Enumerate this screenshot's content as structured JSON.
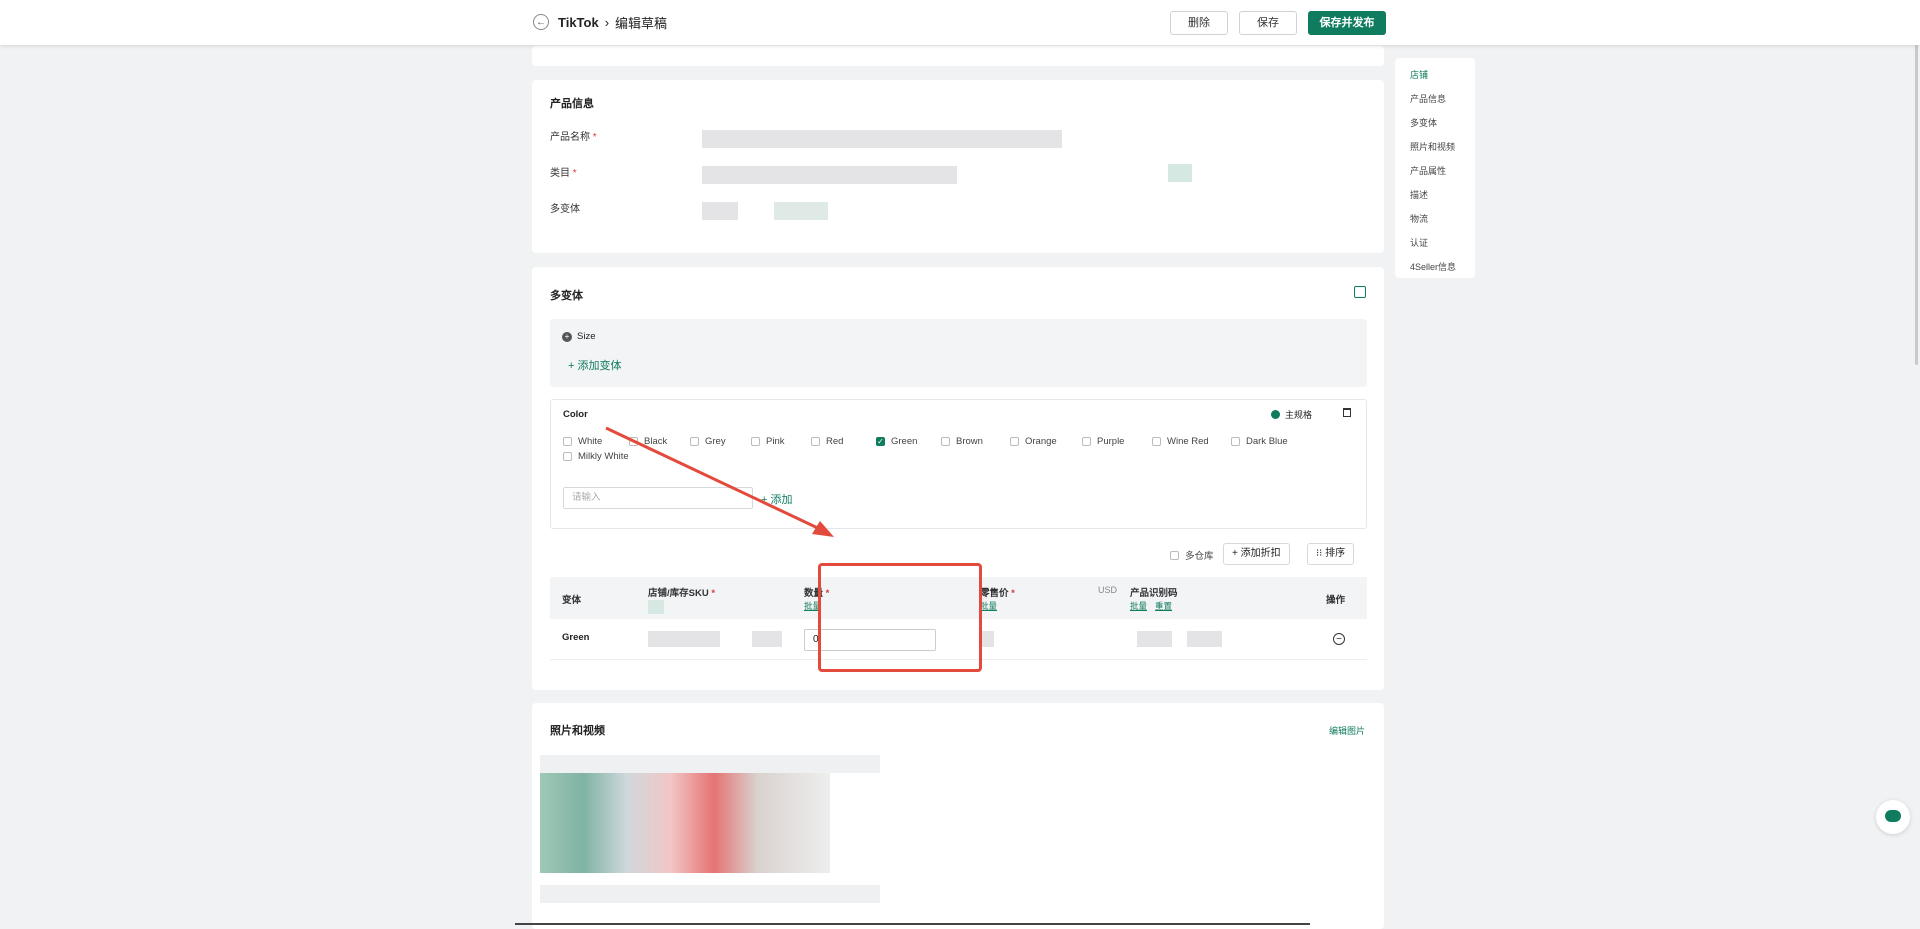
{
  "header": {
    "back_icon": "arrow-left-icon",
    "breadcrumb_root": "TikTok",
    "breadcrumb_sep": "›",
    "breadcrumb_page": "编辑草稿",
    "delete_label": "删除",
    "save_label": "保存",
    "save_publish_label": "保存并发布"
  },
  "product_info": {
    "title": "产品信息",
    "name_label": "产品名称",
    "category_label": "类目",
    "variants_label": "多变体",
    "required_mark": "*"
  },
  "variants": {
    "title": "多变体",
    "size_tag": "Size",
    "add_variant_label": "添加变体",
    "color_title": "Color",
    "main_spec_label": "主规格",
    "colors": [
      {
        "label": "White",
        "checked": false
      },
      {
        "label": "Black",
        "checked": false
      },
      {
        "label": "Grey",
        "checked": false
      },
      {
        "label": "Pink",
        "checked": false
      },
      {
        "label": "Red",
        "checked": false
      },
      {
        "label": "Green",
        "checked": true
      },
      {
        "label": "Brown",
        "checked": false
      },
      {
        "label": "Orange",
        "checked": false
      },
      {
        "label": "Purple",
        "checked": false
      },
      {
        "label": "Wine Red",
        "checked": false
      },
      {
        "label": "Dark Blue",
        "checked": false
      },
      {
        "label": "Milkly White",
        "checked": false
      }
    ],
    "input_placeholder": "请输入",
    "add_label": "添加",
    "multi_warehouse_label": "多仓库",
    "add_discount_label": "添加折扣",
    "sort_label": "排序",
    "table": {
      "col_variant": "变体",
      "col_sku": "店铺/库存SKU",
      "col_qty": "数量",
      "col_price": "零售价",
      "col_currency": "USD",
      "col_id": "产品识别码",
      "col_action": "操作",
      "batch_label": "批量",
      "reset_label": "重置",
      "rows": [
        {
          "variant": "Green",
          "qty": "0"
        }
      ]
    }
  },
  "media": {
    "title": "照片和视频",
    "edit_images_label": "编辑图片"
  },
  "side_nav": {
    "items": [
      "店铺",
      "产品信息",
      "多变体",
      "照片和视频",
      "产品属性",
      "描述",
      "物流",
      "认证",
      "4Seller信息"
    ]
  },
  "colors": {
    "brand": "#0f7b5f",
    "annotation": "#e34a3b"
  }
}
